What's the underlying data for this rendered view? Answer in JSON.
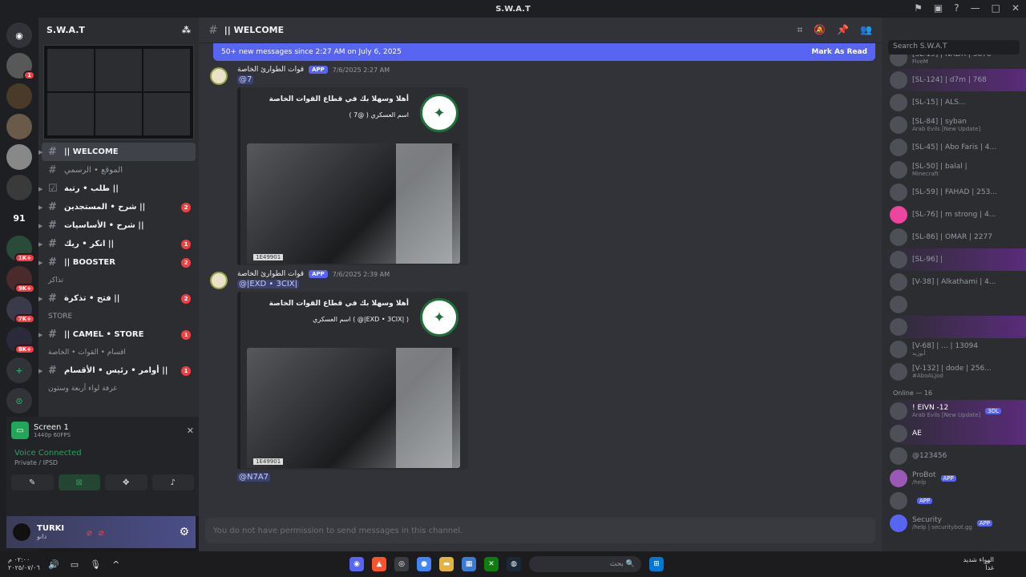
{
  "window": {
    "title": "S.W.A.T"
  },
  "servers": {
    "badges": [
      "1",
      "1K+",
      "9K+",
      "7K+",
      "8K+"
    ],
    "item_91": "91"
  },
  "sidebar": {
    "server_name": "S.W.A.T",
    "channels": [
      {
        "name": "|| WELCOME",
        "active": true,
        "badge": ""
      },
      {
        "name": "الموقع • الرسمي",
        "badge": ""
      },
      {
        "name": "طلب • رتبة ||",
        "badge": ""
      },
      {
        "name": "شرح • المستجدين ||",
        "badge": "2"
      },
      {
        "name": "شرح • الأساسيات ||",
        "badge": ""
      },
      {
        "name": "انكر • ريك ||",
        "badge": "1"
      },
      {
        "name": "|| BOOSTER",
        "badge": "2"
      }
    ],
    "cat_1": "تذاكر",
    "ticket_channel": "فتح • تذكرة ||",
    "ticket_badge": "2",
    "cat_store": "STORE",
    "store_channel": "|| CAMEL • STORE",
    "store_badge": "1",
    "cat_3": "اقسام • القوات • الخاصة",
    "orders_channel": "أوامر • رئيس • الأقسام ||",
    "orders_badge": "1",
    "cat_4": "غرفة لواء أربعة وستون"
  },
  "voice": {
    "screen_title": "Screen 1",
    "screen_sub": "1440p 60FPS",
    "connected": "Voice Connected",
    "sub": "Private / IPSD"
  },
  "user": {
    "name": "TURKI",
    "status": "دانو"
  },
  "channel": {
    "name": "|| WELCOME",
    "new_messages": "50+ new messages since 2:27 AM on July 6, 2025",
    "mark_read": "Mark As Read",
    "input_placeholder": "You do not have permission to send messages in this channel."
  },
  "messages": [
    {
      "author": "قوات الطوارئ الخاصة",
      "app": "APP",
      "time": "7/6/2025 2:27 AM",
      "mention": "@7",
      "embed_title": "أهلا وسهلا بك في قطاع القوات الخاصة",
      "embed_line": "اسم العسكري ( @7 )",
      "plate": "1E49901"
    },
    {
      "author": "قوات الطوارئ الخاصة",
      "app": "APP",
      "time": "7/6/2025 2:39 AM",
      "mention": "@|EXD • 3CIX|",
      "embed_title": "أهلا وسهلا بك في قطاع القوات الخاصة",
      "embed_line": "اسم العسكري ( @|EXD • 3CIX| )",
      "plate": "1E49901"
    }
  ],
  "next_mention": "@N7A7",
  "members": {
    "search": "Search S.W.A.T",
    "list": [
      {
        "name": "[SL-19] | NADR | 5870",
        "sub": "FiveM"
      },
      {
        "name": "[SL-124] | d7m | 768",
        "sub": ""
      },
      {
        "name": "[SL-15] | ALS...",
        "sub": ""
      },
      {
        "name": "[SL-84] | syban",
        "sub": "Arab Evils [New Update]"
      },
      {
        "name": "[SL-45] | Abo Faris | 4...",
        "sub": ""
      },
      {
        "name": "[SL-50] | balal |",
        "sub": "Minecraft"
      },
      {
        "name": "[SL-59] | FAHAD | 253...",
        "sub": ""
      },
      {
        "name": "[SL-76] | m strong | 4...",
        "sub": ""
      },
      {
        "name": "[SL-86] | OMAR | 2277",
        "sub": ""
      },
      {
        "name": "[SL-96] |",
        "sub": ""
      },
      {
        "name": "[V-38] | Alkathami | 4...",
        "sub": ""
      },
      {
        "name": "",
        "sub": ""
      },
      {
        "name": "",
        "sub": ""
      },
      {
        "name": "[V-68] | ... | 13094",
        "sub": "أبوزيد"
      },
      {
        "name": "[V-132] | dode | 256...",
        "sub": "#AboALJod"
      }
    ],
    "online_header": "Online — 16",
    "online": [
      {
        "name": "! EIVN -12",
        "sub": "Arab Evils [New Update]",
        "tag": "3DL"
      },
      {
        "name": "AE",
        "sub": "",
        "tag": ""
      },
      {
        "name": "@123456",
        "sub": "",
        "tag": ""
      },
      {
        "name": "ProBot",
        "sub": "/help",
        "tag": "APP"
      },
      {
        "name": "",
        "sub": "",
        "tag": "APP"
      },
      {
        "name": "Security",
        "sub": "/help | securitybot.gg",
        "tag": "APP"
      }
    ]
  },
  "taskbar": {
    "time": "٠٢:٠٠ م",
    "date": "٢٠٢٥/٠٧/٠٦",
    "search": "بحث",
    "weather": "الهواء شديد",
    "weather_sub": "غداً"
  }
}
